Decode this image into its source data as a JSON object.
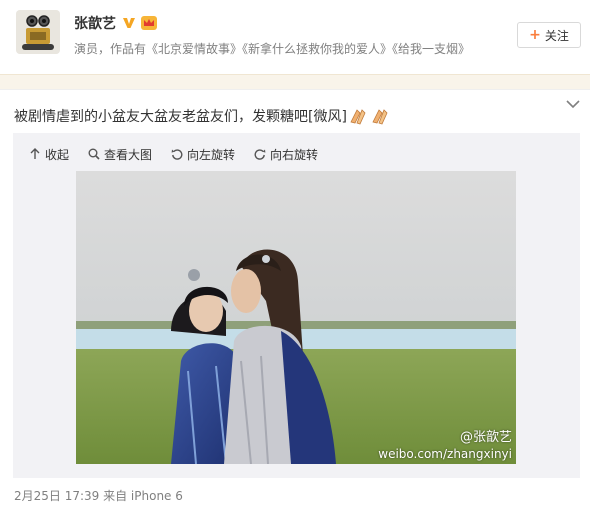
{
  "user": {
    "name": "张歆艺",
    "bio": "演员，作品有《北京爱情故事》《新拿什么拯救你我的爱人》《给我一支烟》",
    "follow_label": "关注"
  },
  "post": {
    "text": "被剧情虐到的小盆友大盆友老盆友们，发颗糖吧[微风]",
    "toolbar": {
      "collapse": "收起",
      "view_large": "查看大图",
      "rotate_left": "向左旋转",
      "rotate_right": "向右旋转"
    },
    "watermark_name": "@张歆艺",
    "watermark_url": "weibo.com/zhangxinyi",
    "meta": "2月25日 17:39 来自 iPhone 6"
  },
  "colors": {
    "accent": "#fa7d3c",
    "vip_badge": "#f5a623",
    "band": "#f9f4ea"
  },
  "icons": [
    "avatar",
    "verified-v-icon",
    "crown-badge-icon",
    "plus-icon",
    "chevron-down-icon",
    "clap-emoji-icon",
    "collapse-icon",
    "search-icon",
    "rotate-left-icon",
    "rotate-right-icon"
  ]
}
